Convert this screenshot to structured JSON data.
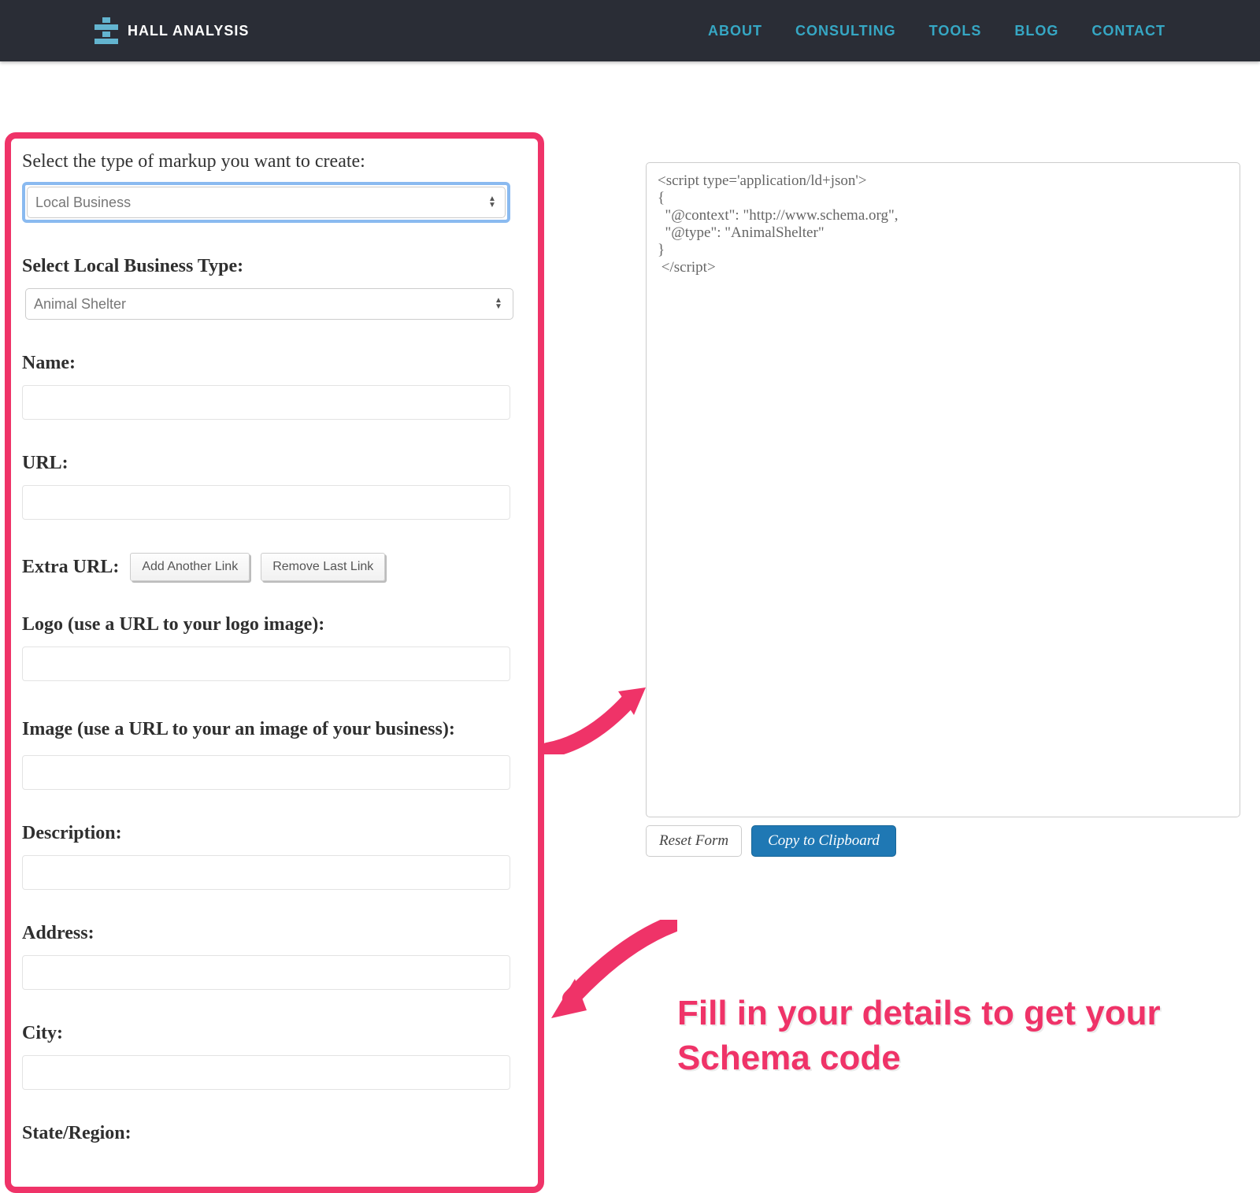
{
  "brand": {
    "name": "HALL ANALYSIS"
  },
  "nav": {
    "about": "ABOUT",
    "consulting": "CONSULTING",
    "tools": "TOOLS",
    "blog": "BLOG",
    "contact": "CONTACT"
  },
  "form": {
    "intro": "Select the type of markup you want to create:",
    "markup_type_value": "Local Business",
    "business_type_label": "Select Local Business Type:",
    "business_type_value": "Animal Shelter",
    "name_label": "Name:",
    "url_label": "URL:",
    "extra_url_label": "Extra URL:",
    "add_link": "Add Another Link",
    "remove_link": "Remove Last Link",
    "logo_label": "Logo (use a URL to your logo image):",
    "image_label": "Image (use a URL to your an image of your business):",
    "description_label": "Description:",
    "address_label": "Address:",
    "city_label": "City:",
    "state_label": "State/Region:"
  },
  "output": {
    "code": "<script type='application/ld+json'>\n{\n  \"@context\": \"http://www.schema.org\",\n  \"@type\": \"AnimalShelter\"\n}\n </script>",
    "reset": "Reset Form",
    "copy": "Copy to Clipboard"
  },
  "annotation": {
    "callout": "Fill in your details to get your Schema code"
  },
  "colors": {
    "accent_pink": "#ef3368",
    "nav_teal": "#36a7c4",
    "header_bg": "#2a2d36",
    "primary_blue": "#1f78b4"
  }
}
